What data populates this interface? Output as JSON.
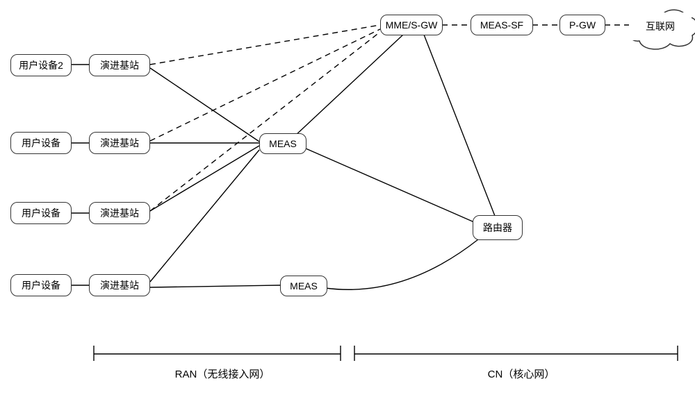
{
  "nodes": {
    "ue2": {
      "label": "用户设备2"
    },
    "ue_a": {
      "label": "用户设备"
    },
    "ue_b": {
      "label": "用户设备"
    },
    "ue_c": {
      "label": "用户设备"
    },
    "enb1": {
      "label": "演进基站"
    },
    "enb2": {
      "label": "演进基站"
    },
    "enb3": {
      "label": "演进基站"
    },
    "enb4": {
      "label": "演进基站"
    },
    "meas1": {
      "label": "MEAS"
    },
    "meas2": {
      "label": "MEAS"
    },
    "mme": {
      "label": "MME/S-GW"
    },
    "meassf": {
      "label": "MEAS-SF"
    },
    "pgw": {
      "label": "P-GW"
    },
    "router": {
      "label": "路由器"
    },
    "internet": {
      "label": "互联网"
    }
  },
  "annotations": {
    "ran": "RAN（无线接入网）",
    "cn": "CN（核心网）"
  },
  "chart_data": {
    "type": "diagram",
    "title": "",
    "nodes": [
      {
        "id": "ue2",
        "label": "用户设备2",
        "group": "RAN"
      },
      {
        "id": "ue_a",
        "label": "用户设备",
        "group": "RAN"
      },
      {
        "id": "ue_b",
        "label": "用户设备",
        "group": "RAN"
      },
      {
        "id": "ue_c",
        "label": "用户设备",
        "group": "RAN"
      },
      {
        "id": "enb1",
        "label": "演进基站",
        "group": "RAN"
      },
      {
        "id": "enb2",
        "label": "演进基站",
        "group": "RAN"
      },
      {
        "id": "enb3",
        "label": "演进基站",
        "group": "RAN"
      },
      {
        "id": "enb4",
        "label": "演进基站",
        "group": "RAN"
      },
      {
        "id": "meas1",
        "label": "MEAS",
        "group": "CN"
      },
      {
        "id": "meas2",
        "label": "MEAS",
        "group": "CN"
      },
      {
        "id": "mme",
        "label": "MME/S-GW",
        "group": "CN"
      },
      {
        "id": "meassf",
        "label": "MEAS-SF",
        "group": "CN"
      },
      {
        "id": "pgw",
        "label": "P-GW",
        "group": "CN"
      },
      {
        "id": "router",
        "label": "路由器",
        "group": "CN"
      },
      {
        "id": "internet",
        "label": "互联网",
        "group": "external"
      }
    ],
    "edges": [
      {
        "from": "ue2",
        "to": "enb1",
        "style": "solid"
      },
      {
        "from": "ue_a",
        "to": "enb2",
        "style": "solid"
      },
      {
        "from": "ue_b",
        "to": "enb3",
        "style": "solid"
      },
      {
        "from": "ue_c",
        "to": "enb4",
        "style": "solid"
      },
      {
        "from": "enb1",
        "to": "mme",
        "style": "dashed"
      },
      {
        "from": "enb2",
        "to": "mme",
        "style": "dashed"
      },
      {
        "from": "enb3",
        "to": "mme",
        "style": "dashed"
      },
      {
        "from": "enb1",
        "to": "meas1",
        "style": "solid"
      },
      {
        "from": "enb2",
        "to": "meas1",
        "style": "solid"
      },
      {
        "from": "enb3",
        "to": "meas1",
        "style": "solid"
      },
      {
        "from": "enb4",
        "to": "meas1",
        "style": "solid"
      },
      {
        "from": "enb4",
        "to": "meas2",
        "style": "solid"
      },
      {
        "from": "meas1",
        "to": "mme",
        "style": "solid"
      },
      {
        "from": "mme",
        "to": "router",
        "style": "solid"
      },
      {
        "from": "meas1",
        "to": "router",
        "style": "solid"
      },
      {
        "from": "meas2",
        "to": "router",
        "style": "solid"
      },
      {
        "from": "mme",
        "to": "meassf",
        "style": "dashed"
      },
      {
        "from": "meassf",
        "to": "pgw",
        "style": "dashed"
      },
      {
        "from": "pgw",
        "to": "internet",
        "style": "dashed"
      }
    ],
    "groups": [
      {
        "id": "RAN",
        "label": "RAN（无线接入网）"
      },
      {
        "id": "CN",
        "label": "CN（核心网）"
      }
    ]
  }
}
